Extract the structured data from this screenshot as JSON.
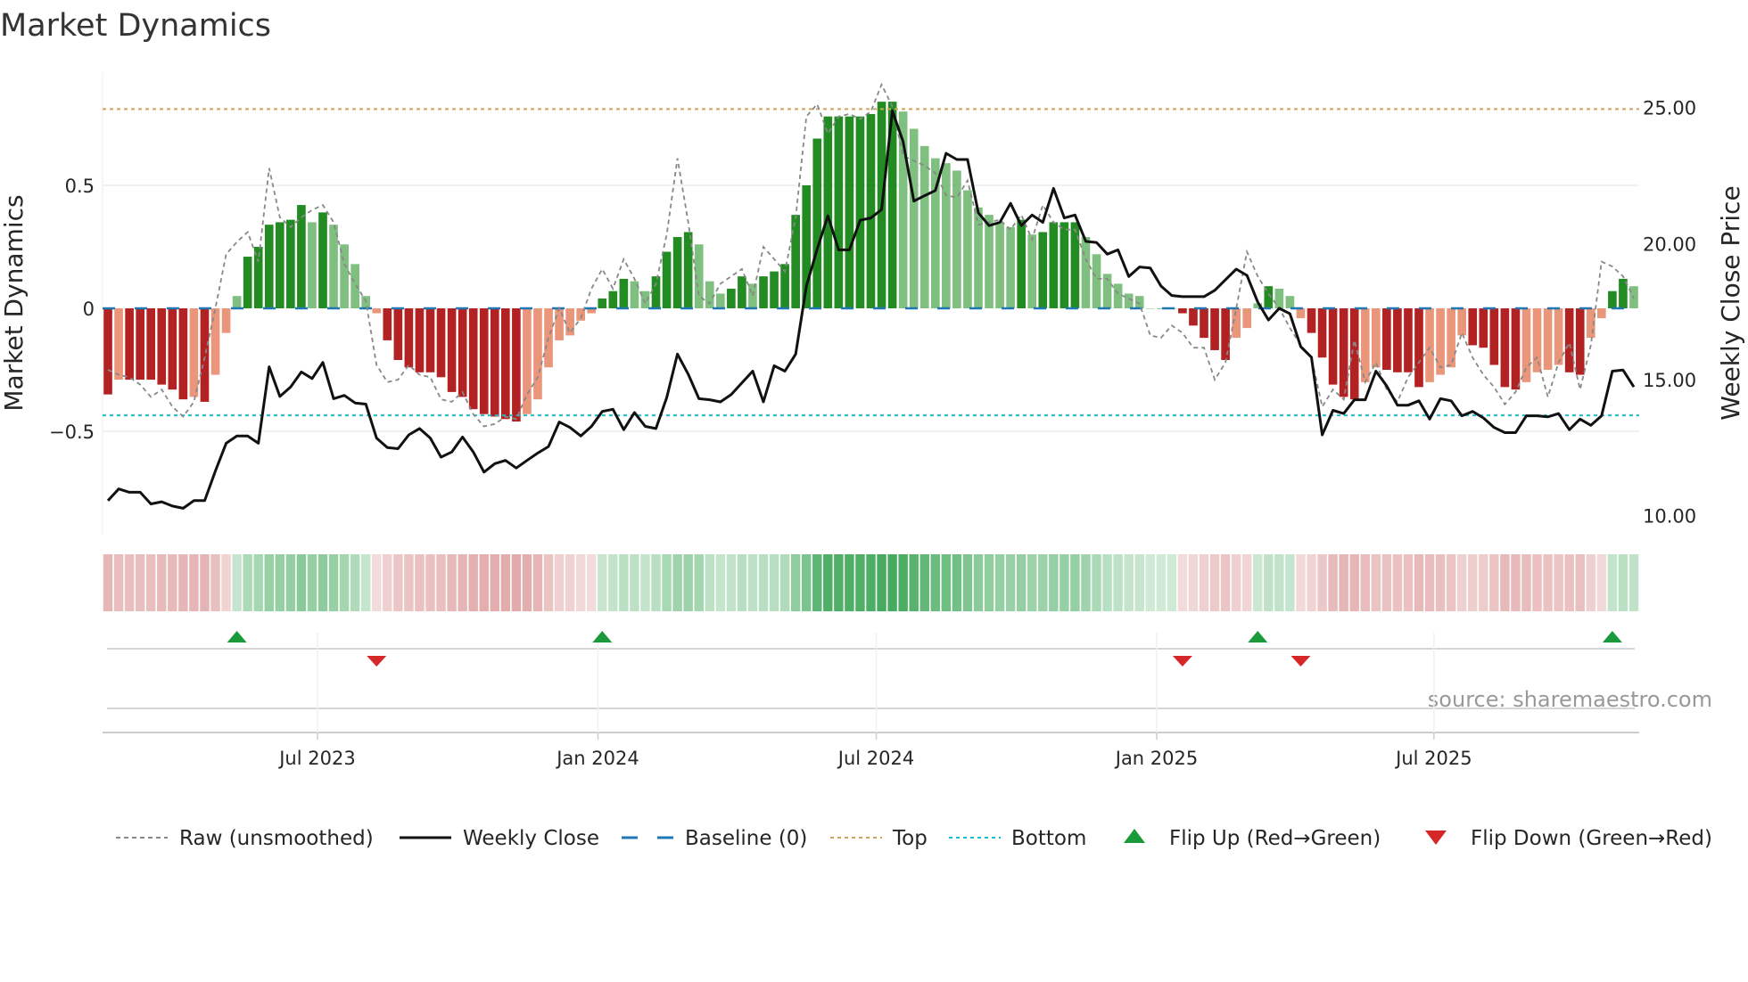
{
  "chart_data": {
    "type": "bar",
    "title": "Market Dynamics",
    "ylabel": "Market Dynamics",
    "y2label": "Weekly Close Price",
    "ylim": [
      -0.92,
      0.96
    ],
    "y2lim": [
      9.3,
      26.3
    ],
    "yticks": [
      {
        "v": 0.5,
        "label": "0.5"
      },
      {
        "v": 0,
        "label": "0"
      },
      {
        "v": -0.5,
        "label": "−0.5"
      }
    ],
    "y2ticks": [
      {
        "v": 25,
        "label": "25.00"
      },
      {
        "v": 20,
        "label": "20.00"
      },
      {
        "v": 15,
        "label": "15.00"
      },
      {
        "v": 10,
        "label": "10.00"
      }
    ],
    "xticks": [
      {
        "week": 19.5,
        "label": "Jul 2023"
      },
      {
        "week": 45.6,
        "label": "Jan 2024"
      },
      {
        "week": 71.5,
        "label": "Jul 2024"
      },
      {
        "week": 97.6,
        "label": "Jan 2025"
      },
      {
        "week": 123.4,
        "label": "Jul 2025"
      }
    ],
    "top_level": 0.81,
    "bottom_level": -0.435,
    "baseline": 0,
    "grid": true,
    "legend_position": "bottom",
    "source": "source: sharemaestro.com",
    "colors": {
      "up_strong": "#228b22",
      "up_weak": "#7fbf7f",
      "down_strong": "#b22222",
      "down_weak": "#e9967a",
      "close": "#111111",
      "raw": "#888888",
      "baseline": "#1f77b4",
      "top": "#d4a35a",
      "bottom": "#17becf",
      "flip_up": "#1a9a3a",
      "flip_down": "#d62728"
    },
    "dynamics": [
      -0.35,
      -0.29,
      -0.29,
      -0.29,
      -0.29,
      -0.31,
      -0.33,
      -0.37,
      -0.36,
      -0.38,
      -0.27,
      -0.1,
      0.05,
      0.21,
      0.25,
      0.34,
      0.35,
      0.36,
      0.42,
      0.35,
      0.39,
      0.34,
      0.26,
      0.18,
      0.05,
      -0.02,
      -0.13,
      -0.21,
      -0.24,
      -0.26,
      -0.26,
      -0.28,
      -0.34,
      -0.36,
      -0.41,
      -0.43,
      -0.44,
      -0.45,
      -0.46,
      -0.43,
      -0.37,
      -0.24,
      -0.13,
      -0.11,
      -0.05,
      -0.02,
      0.04,
      0.07,
      0.12,
      0.11,
      0.07,
      0.13,
      0.23,
      0.29,
      0.31,
      0.26,
      0.11,
      0.06,
      0.08,
      0.13,
      0.1,
      0.13,
      0.15,
      0.18,
      0.38,
      0.5,
      0.69,
      0.78,
      0.78,
      0.78,
      0.78,
      0.79,
      0.84,
      0.84,
      0.8,
      0.73,
      0.66,
      0.61,
      0.59,
      0.56,
      0.48,
      0.41,
      0.38,
      0.35,
      0.33,
      0.36,
      0.3,
      0.31,
      0.35,
      0.35,
      0.35,
      0.29,
      0.22,
      0.14,
      0.1,
      0.06,
      0.05,
      0.0,
      0.0,
      0.0,
      -0.02,
      -0.07,
      -0.12,
      -0.17,
      -0.21,
      -0.12,
      -0.08,
      0.02,
      0.09,
      0.08,
      0.05,
      -0.04,
      -0.1,
      -0.2,
      -0.31,
      -0.36,
      -0.37,
      -0.3,
      -0.24,
      -0.25,
      -0.26,
      -0.26,
      -0.32,
      -0.3,
      -0.27,
      -0.24,
      -0.11,
      -0.15,
      -0.16,
      -0.23,
      -0.32,
      -0.33,
      -0.3,
      -0.26,
      -0.25,
      -0.23,
      -0.26,
      -0.27,
      -0.12,
      -0.04,
      0.07,
      0.12,
      0.09
    ],
    "raw": [
      -0.25,
      -0.27,
      -0.28,
      -0.31,
      -0.36,
      -0.33,
      -0.4,
      -0.44,
      -0.38,
      -0.2,
      0.0,
      0.22,
      0.27,
      0.31,
      0.19,
      0.57,
      0.37,
      0.33,
      0.37,
      0.4,
      0.42,
      0.35,
      0.18,
      0.1,
      0.03,
      -0.23,
      -0.3,
      -0.29,
      -0.23,
      -0.27,
      -0.28,
      -0.37,
      -0.38,
      -0.34,
      -0.43,
      -0.48,
      -0.47,
      -0.44,
      -0.45,
      -0.35,
      -0.28,
      -0.12,
      0.0,
      -0.1,
      -0.04,
      0.08,
      0.16,
      0.08,
      0.2,
      0.12,
      0.02,
      0.1,
      0.3,
      0.61,
      0.35,
      0.05,
      0.02,
      0.1,
      0.13,
      0.16,
      0.05,
      0.25,
      0.2,
      0.15,
      0.37,
      0.78,
      0.83,
      0.71,
      0.78,
      0.79,
      0.77,
      0.8,
      0.91,
      0.82,
      0.62,
      0.6,
      0.58,
      0.55,
      0.46,
      0.45,
      0.52,
      0.34,
      0.35,
      0.36,
      0.32,
      0.38,
      0.28,
      0.42,
      0.35,
      0.32,
      0.32,
      0.2,
      0.12,
      0.12,
      0.06,
      0.04,
      0.02,
      -0.11,
      -0.12,
      -0.07,
      -0.1,
      -0.16,
      -0.16,
      -0.29,
      -0.22,
      0.0,
      0.23,
      0.13,
      0.06,
      0.0,
      -0.08,
      -0.15,
      -0.2,
      -0.4,
      -0.33,
      -0.37,
      -0.13,
      -0.3,
      -0.22,
      -0.33,
      -0.38,
      -0.28,
      -0.22,
      -0.16,
      -0.24,
      -0.23,
      -0.1,
      -0.2,
      -0.27,
      -0.32,
      -0.39,
      -0.34,
      -0.24,
      -0.2,
      -0.36,
      -0.22,
      -0.14,
      -0.33,
      -0.15,
      0.19,
      0.17,
      0.13,
      0.04
    ],
    "close": [
      10.55,
      10.98,
      10.86,
      10.86,
      10.43,
      10.51,
      10.35,
      10.27,
      10.55,
      10.55,
      11.64,
      12.66,
      12.93,
      12.93,
      12.66,
      15.47,
      14.38,
      14.73,
      15.28,
      15.04,
      15.63,
      14.3,
      14.42,
      14.14,
      14.1,
      12.85,
      12.5,
      12.46,
      12.97,
      13.2,
      12.85,
      12.15,
      12.34,
      12.89,
      12.34,
      11.6,
      11.91,
      12.03,
      11.75,
      12.03,
      12.3,
      12.54,
      13.44,
      13.24,
      12.93,
      13.28,
      13.83,
      13.91,
      13.16,
      13.79,
      13.28,
      13.2,
      14.34,
      15.94,
      15.2,
      14.3,
      14.26,
      14.18,
      14.45,
      14.88,
      15.31,
      14.18,
      15.51,
      15.31,
      15.94,
      18.44,
      19.8,
      21.02,
      19.77,
      19.77,
      20.86,
      20.94,
      21.25,
      24.88,
      23.75,
      21.56,
      21.76,
      21.95,
      23.32,
      23.09,
      23.09,
      21.13,
      20.66,
      20.78,
      21.48,
      20.66,
      21.05,
      20.78,
      22.03,
      20.94,
      21.05,
      20.08,
      20.04,
      19.61,
      19.77,
      18.79,
      19.14,
      19.1,
      18.44,
      18.09,
      18.05,
      18.05,
      18.05,
      18.28,
      18.67,
      19.06,
      18.83,
      17.85,
      17.19,
      17.62,
      17.42,
      16.21,
      15.82,
      12.97,
      13.87,
      13.75,
      14.26,
      14.26,
      15.31,
      14.77,
      14.06,
      14.06,
      14.22,
      13.55,
      14.3,
      14.22,
      13.67,
      13.83,
      13.59,
      13.24,
      13.05,
      13.05,
      13.67,
      13.67,
      13.63,
      13.75,
      13.16,
      13.55,
      13.32,
      13.67,
      15.31,
      15.35,
      14.73
    ]
  },
  "flip_up_weeks": [
    12,
    46,
    107,
    140
  ],
  "flip_down_weeks": [
    25,
    100,
    111
  ],
  "legend": [
    {
      "key": "raw",
      "label": "Raw (unsmoothed)"
    },
    {
      "key": "close",
      "label": "Weekly Close"
    },
    {
      "key": "baseline",
      "label": "Baseline (0)"
    },
    {
      "key": "top",
      "label": "Top"
    },
    {
      "key": "bottom",
      "label": "Bottom"
    },
    {
      "key": "flip_up",
      "label": "Flip Up (Red→Green)"
    },
    {
      "key": "flip_down",
      "label": "Flip Down (Green→Red)"
    }
  ]
}
